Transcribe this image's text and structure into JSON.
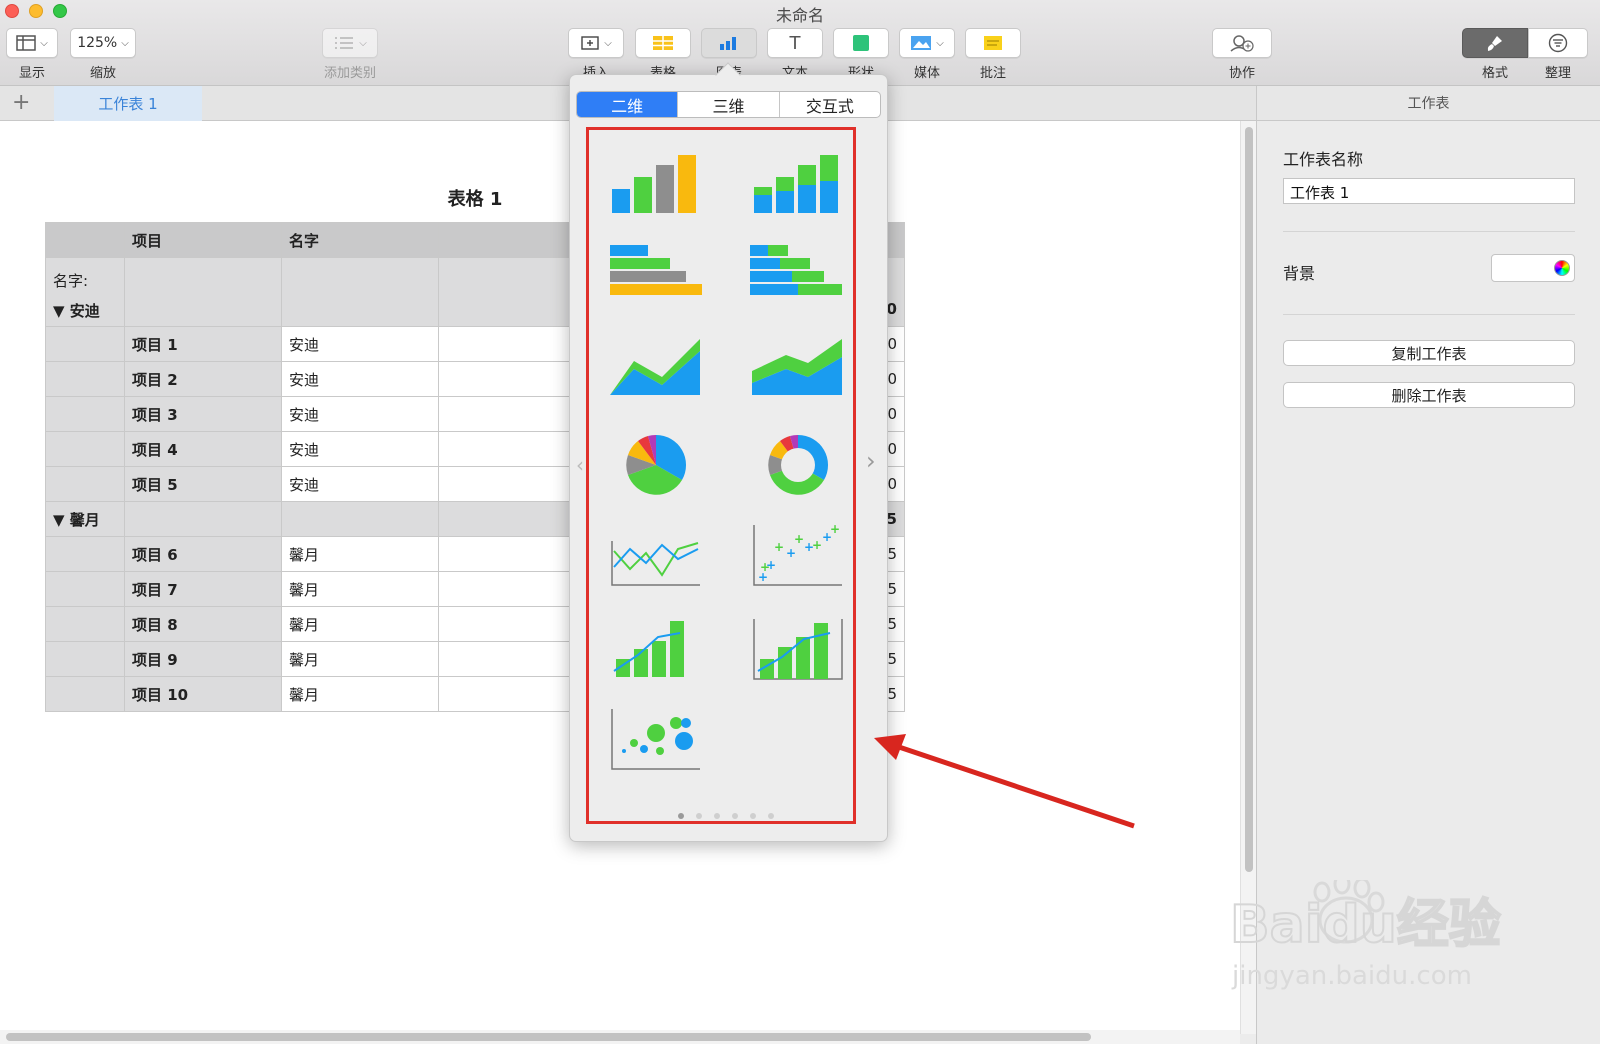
{
  "window": {
    "title": "未命名"
  },
  "toolbar": {
    "view_label": "显示",
    "zoom_value": "125%",
    "zoom_label": "缩放",
    "category_label": "添加类别",
    "insert_label": "插入",
    "table_label": "表格",
    "chart_label": "图表",
    "text_label": "文本",
    "shape_label": "形状",
    "media_label": "媒体",
    "comment_label": "批注",
    "collab_label": "协作",
    "format_label": "格式",
    "organize_label": "整理"
  },
  "tabs": {
    "add": "+",
    "sheet1": "工作表 1"
  },
  "table": {
    "title": "表格 1",
    "headers": [
      "项目",
      "名字"
    ],
    "group_label_prefix": "名字:",
    "groups": [
      {
        "name": "安迪",
        "total_tail": "50",
        "rows": [
          {
            "item": "项目 1",
            "name": "安迪",
            "tail": "0"
          },
          {
            "item": "项目 2",
            "name": "安迪",
            "tail": "20"
          },
          {
            "item": "项目 3",
            "name": "安迪",
            "tail": "0"
          },
          {
            "item": "项目 4",
            "name": "安迪",
            "tail": "0"
          },
          {
            "item": "项目 5",
            "name": "安迪",
            "tail": "0"
          }
        ]
      },
      {
        "name": "馨月",
        "total_tail": "25",
        "rows": [
          {
            "item": "项目 6",
            "name": "馨月",
            "tail": "5"
          },
          {
            "item": "项目 7",
            "name": "馨月",
            "tail": "5"
          },
          {
            "item": "项目 8",
            "name": "馨月",
            "tail": "25"
          },
          {
            "item": "项目 9",
            "name": "馨月",
            "tail": "5"
          },
          {
            "item": "项目 10",
            "name": "馨月",
            "tail": "5"
          }
        ]
      }
    ]
  },
  "chart_popover": {
    "segments": [
      "二维",
      "三维",
      "交互式"
    ],
    "selected_segment": "二维",
    "chart_types": [
      "column",
      "stacked-column",
      "bar",
      "stacked-bar",
      "area",
      "stacked-area",
      "pie",
      "donut",
      "line",
      "scatter",
      "mixed",
      "two-axis",
      "bubble"
    ],
    "page_count": 6,
    "current_page": 1
  },
  "sidebar": {
    "header": "工作表",
    "sheet_name_label": "工作表名称",
    "sheet_name_value": "工作表 1",
    "background_label": "背景",
    "duplicate_button": "复制工作表",
    "delete_button": "删除工作表"
  },
  "watermark": {
    "brand": "Baidu经验",
    "url": "jingyan.baidu.com"
  },
  "colors": {
    "accent": "#2f7ef6",
    "highlight_red": "#e0302a",
    "chart_blue": "#1a9cf0",
    "chart_green": "#4fd040",
    "chart_gray": "#8e8e8e",
    "chart_yellow": "#f9b90e"
  }
}
